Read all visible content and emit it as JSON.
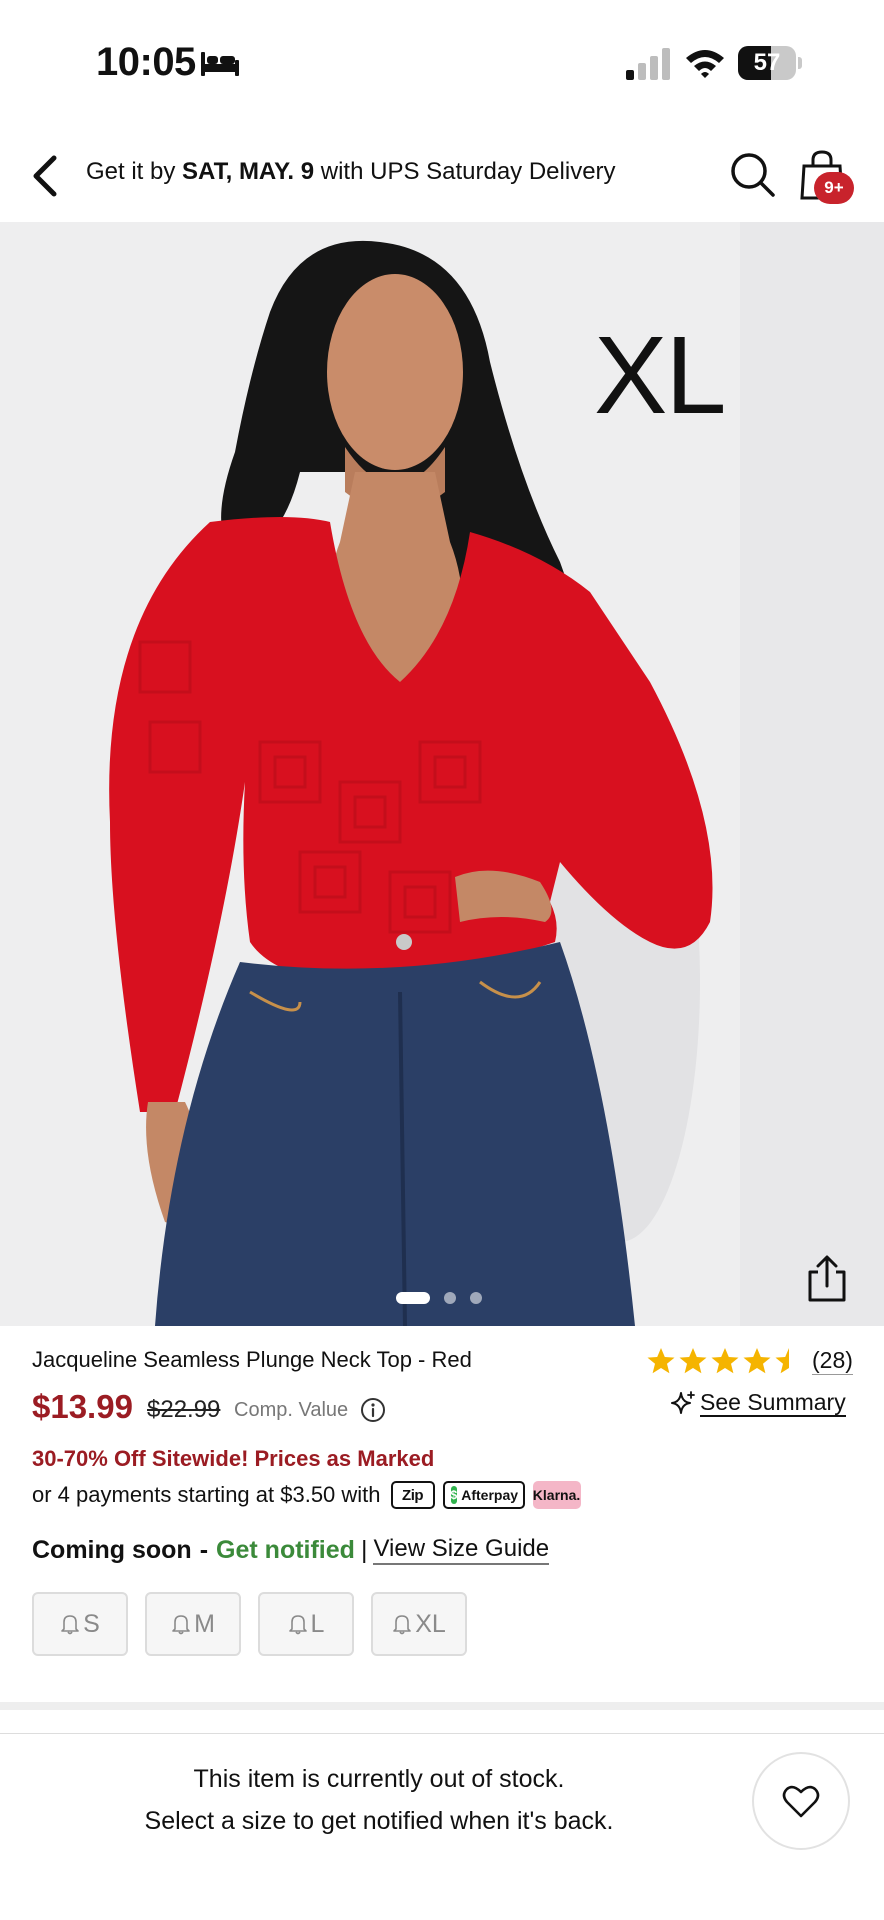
{
  "status_bar": {
    "time": "10:05",
    "battery_level": "57",
    "battery_fraction": 0.57
  },
  "header": {
    "delivery_prefix": "Get it by ",
    "delivery_date": "SAT, MAY. 9",
    "delivery_suffix": " with UPS Saturday Delivery",
    "cart_badge": "9+"
  },
  "gallery": {
    "size_overlay": "XL",
    "image_count": 3,
    "active_index": 0
  },
  "product": {
    "name": "Jacqueline Seamless Plunge Neck Top - Red",
    "rating": 4.5,
    "review_count": "(28)",
    "price": "$13.99",
    "original_price": "$22.99",
    "comp_value_label": "Comp. Value",
    "see_summary_label": "See Summary",
    "promo": "30-70% Off Sitewide! Prices as Marked",
    "payments_text": "or 4 payments starting at $3.50 with",
    "payment_badges": {
      "zip": "Zip",
      "afterpay": "Afterpay",
      "klarna": "Klarna."
    }
  },
  "availability": {
    "coming_soon": "Coming soon",
    "dash": "-",
    "get_notified": "Get notified",
    "separator": "|",
    "size_guide": "View Size Guide",
    "sizes": [
      "S",
      "M",
      "L",
      "XL"
    ]
  },
  "footer": {
    "line1": "This item is currently out of stock.",
    "line2": "Select a size to get notified when it's back."
  },
  "colors": {
    "price_red": "#9b1c23",
    "badge_red": "#c8232c",
    "notify_green": "#3b8a3a",
    "star_yellow": "#f5b400",
    "top_red": "#d8101f",
    "denim": "#2b3f66"
  }
}
